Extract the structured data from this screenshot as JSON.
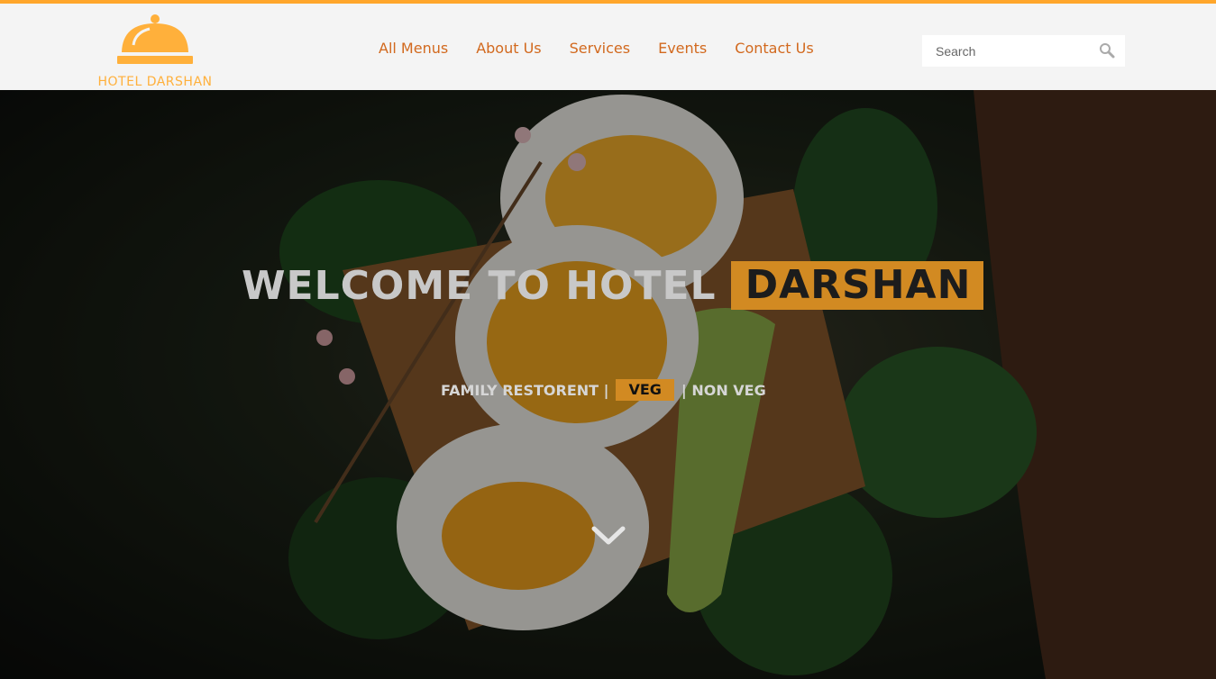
{
  "brand": {
    "name": "HOTEL DARSHAN",
    "accent_color": "#ffa62b",
    "nav_color": "#d2691e",
    "logo_icon": "cloche-icon"
  },
  "nav": {
    "items": [
      {
        "label": "All Menus"
      },
      {
        "label": "About Us"
      },
      {
        "label": "Services"
      },
      {
        "label": "Events"
      },
      {
        "label": "Contact Us"
      }
    ]
  },
  "search": {
    "placeholder": "Search",
    "icon": "search-icon"
  },
  "hero": {
    "title_plain": "WELCOME TO HOTEL",
    "title_highlight": "DARSHAN",
    "highlight_color": "#d28a22",
    "tagline_left": "FAMILY RESTORENT |",
    "tagline_highlight": "VEG",
    "tagline_right": "| NON VEG",
    "scroll_icon": "chevron-down-icon"
  }
}
